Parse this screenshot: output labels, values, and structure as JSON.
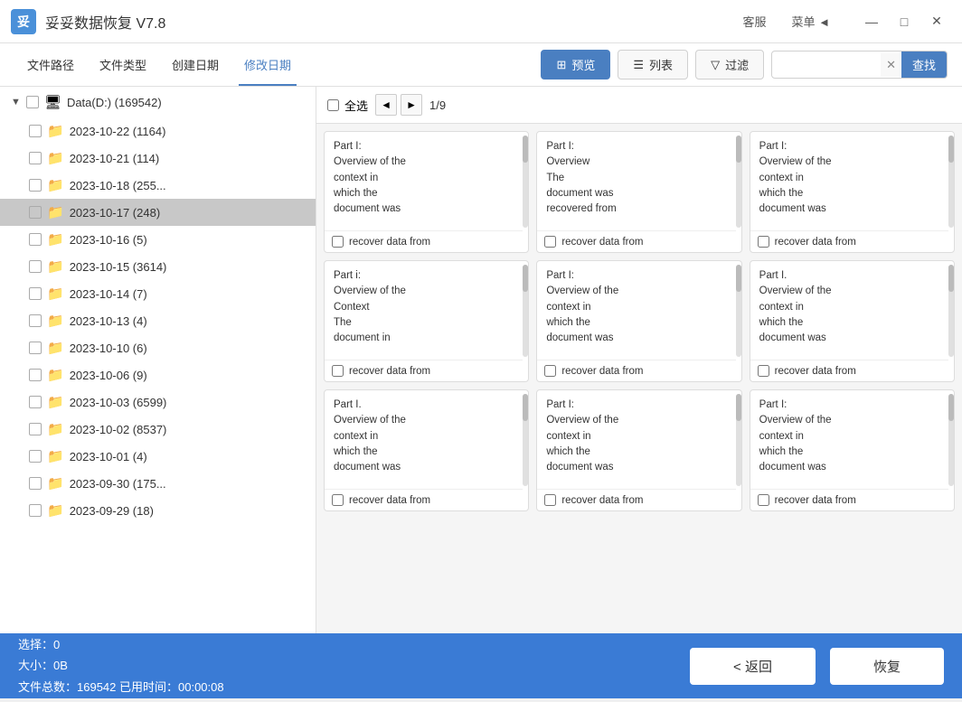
{
  "titleBar": {
    "appName": "妥妥数据恢复",
    "version": "V7.8",
    "iconText": "妥",
    "customerService": "客服",
    "menu": "菜单",
    "menuArrow": "◄",
    "minimizeLabel": "—",
    "maximizeLabel": "□",
    "closeLabel": "✕"
  },
  "toolbar": {
    "navTabs": [
      {
        "label": "文件路径",
        "active": false
      },
      {
        "label": "文件类型",
        "active": false
      },
      {
        "label": "创建日期",
        "active": false
      },
      {
        "label": "修改日期",
        "active": true
      }
    ],
    "previewBtn": "预览",
    "listBtn": "列表",
    "filterBtn": "过滤",
    "searchPlaceholder": "",
    "searchClear": "✕",
    "searchBtn": "查找"
  },
  "treePanel": {
    "rootLabel": "Data(D:)  (169542)",
    "items": [
      {
        "label": "2023-10-22 (1164)",
        "selected": false
      },
      {
        "label": "2023-10-21 (114)",
        "selected": false
      },
      {
        "label": "2023-10-18 (255...",
        "selected": false
      },
      {
        "label": "2023-10-17 (248)",
        "selected": true
      },
      {
        "label": "2023-10-16 (5)",
        "selected": false
      },
      {
        "label": "2023-10-15 (3614)",
        "selected": false
      },
      {
        "label": "2023-10-14 (7)",
        "selected": false
      },
      {
        "label": "2023-10-13 (4)",
        "selected": false
      },
      {
        "label": "2023-10-10 (6)",
        "selected": false
      },
      {
        "label": "2023-10-06 (9)",
        "selected": false
      },
      {
        "label": "2023-10-03 (6599)",
        "selected": false
      },
      {
        "label": "2023-10-02 (8537)",
        "selected": false
      },
      {
        "label": "2023-10-01 (4)",
        "selected": false
      },
      {
        "label": "2023-09-30 (175...",
        "selected": false
      },
      {
        "label": "2023-09-29 (18)",
        "selected": false
      }
    ]
  },
  "gridPanel": {
    "selectAllLabel": "全选",
    "prevArrow": "◄",
    "nextArrow": "►",
    "pageInfo": "1/9",
    "items": [
      {
        "previewText": "<p>Part I:\nOverview of the\ncontext in\nwhich the\ndocument was",
        "footerText": "recover data from"
      },
      {
        "previewText": "<p>Part I:\nOverview</\np><p>The\ndocument was\nrecovered from",
        "footerText": "recover data from"
      },
      {
        "previewText": "<p>Part I:\nOverview of the\ncontext in\nwhich the\ndocument was",
        "footerText": "recover data from"
      },
      {
        "previewText": "<p>Part i:\nOverview of the\nContext</\np><p>The\ndocument in",
        "footerText": "recover data from"
      },
      {
        "previewText": "<p>Part I:\nOverview of the\ncontext in\nwhich the\ndocument was",
        "footerText": "recover data from"
      },
      {
        "previewText": "<p>Part I.\nOverview of the\ncontext in\nwhich the\ndocument was",
        "footerText": "recover data from"
      },
      {
        "previewText": "<p>Part I.\nOverview of the\ncontext in\nwhich the\ndocument was",
        "footerText": "recover data from"
      },
      {
        "previewText": "<p>Part I:\nOverview of the\ncontext in\nwhich the\ndocument was",
        "footerText": "recover data from"
      },
      {
        "previewText": "<p>Part I:\nOverview of the\ncontext in\nwhich the\ndocument was",
        "footerText": "recover data from"
      }
    ]
  },
  "statusBar": {
    "line1": "选择：0",
    "line2": "大小：0B",
    "line3": "文件总数：169542   已用时间：00:00:08",
    "returnBtn": "< 返回",
    "restoreBtn": "恢复"
  }
}
